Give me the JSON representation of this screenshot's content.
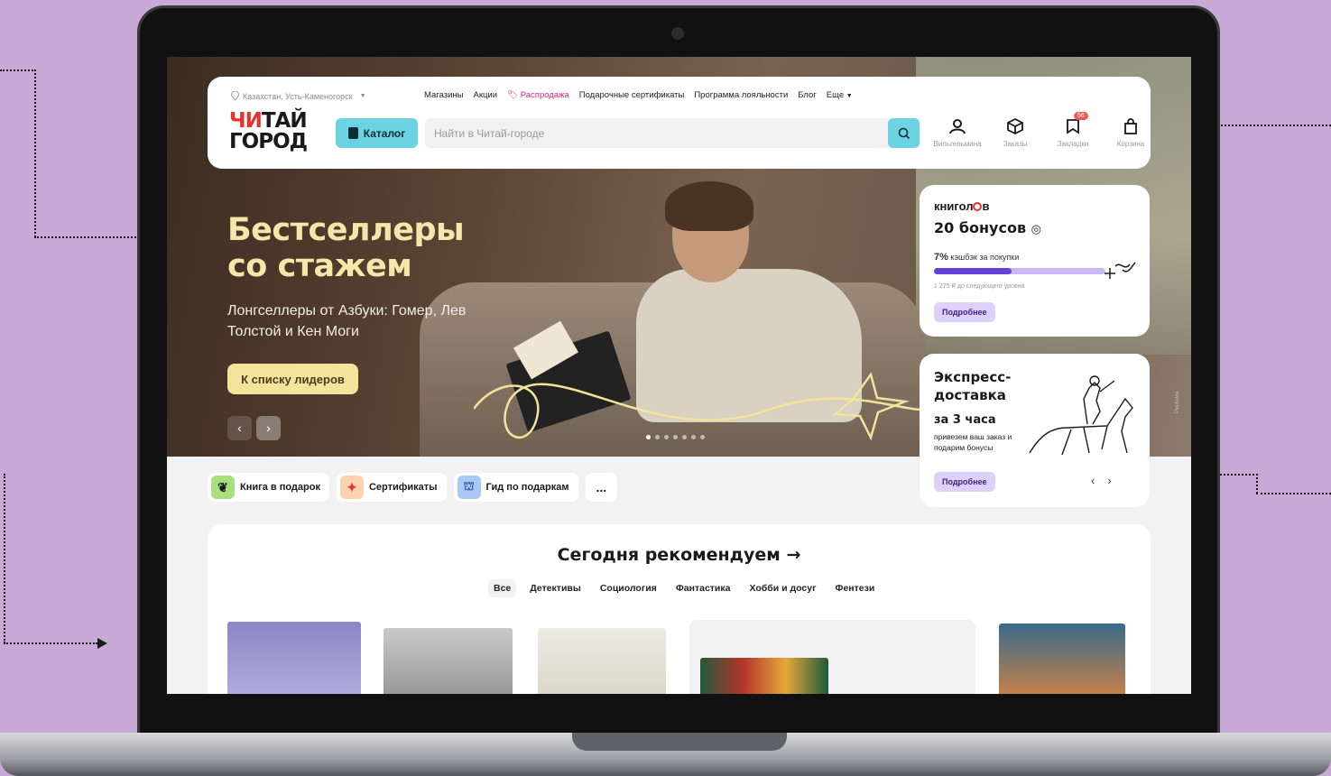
{
  "header": {
    "location": "Казахстан, Усть-Каменогорск",
    "nav": [
      "Магазины",
      "Акции",
      "Распродажа",
      "Подарочные сертификаты",
      "Программа лояльности",
      "Блог",
      "Еще"
    ],
    "logo_line1_a": "ЧИ",
    "logo_line1_b": "ТАЙ",
    "logo_line2": "ГОРОД",
    "catalog_label": "Каталог",
    "search_placeholder": "Найти в Читай-городе",
    "icons": [
      {
        "label": "Вильгельмина",
        "icon": "user-icon"
      },
      {
        "label": "Заказы",
        "icon": "box-icon"
      },
      {
        "label": "Закладки",
        "icon": "bookmark-icon",
        "badge": "56"
      },
      {
        "label": "Корзина",
        "icon": "bag-icon"
      }
    ]
  },
  "hero": {
    "title_line1": "Бестселлеры",
    "title_line2": "со стажем",
    "subtitle": "Лонгселлеры от Азбуки: Гомер, Лев Толстой и Кен Моги",
    "button": "К списку лидеров",
    "prev": "‹",
    "next": "›"
  },
  "bonus_card": {
    "brand_a": "книгол",
    "brand_b": "в",
    "amount": "20 бонусов",
    "cashback_pct": "7%",
    "cashback_text": "кэшбэк за покупки",
    "progress": 0.45,
    "progress_note": "1 275 ₽ до следующего уровня",
    "button": "Подробнее"
  },
  "delivery_card": {
    "title": "Экспресс-доставка",
    "time": "за 3 часа",
    "text": "привезем ваш заказ и подарим бонусы",
    "button": "Подробнее",
    "prev": "‹",
    "next": "›"
  },
  "side_tag": "Реклама",
  "chips": [
    {
      "label": "Книга в подарок",
      "color": "#a8e07c"
    },
    {
      "label": "Сертификаты",
      "color": "#ffd1b0"
    },
    {
      "label": "Гид по подаркам",
      "color": "#a9c9f5"
    }
  ],
  "chips_more": "...",
  "recommend": {
    "title": "Сегодня рекомендуем →",
    "tabs": [
      "Все",
      "Детективы",
      "Социология",
      "Фантастика",
      "Хобби и досуг",
      "Фентези"
    ]
  },
  "colors": {
    "accent": "#6cd3e3",
    "bonus_purple": "#6a3fd8",
    "hero_title": "#f6e6a9",
    "background": "#c9a9d6"
  }
}
